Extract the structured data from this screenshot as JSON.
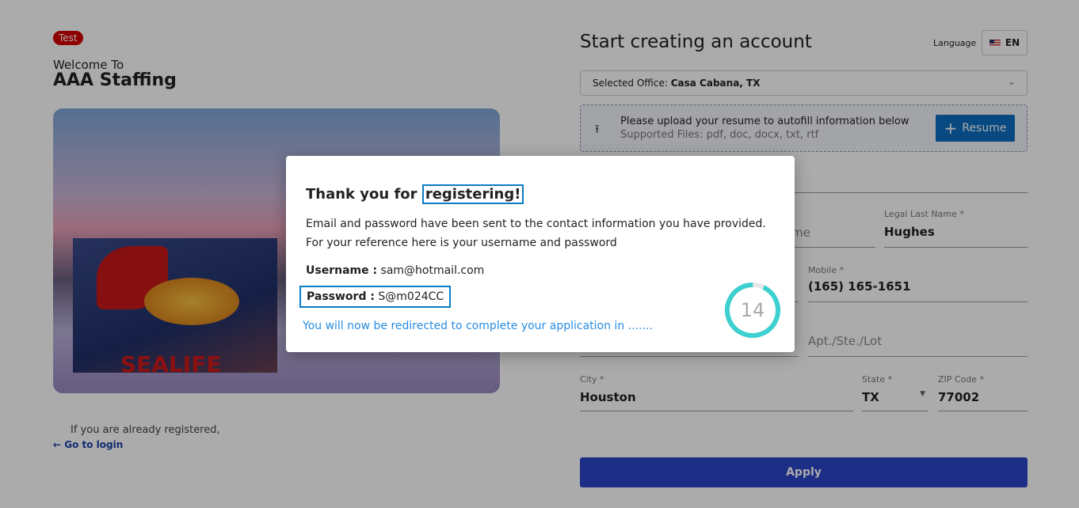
{
  "left": {
    "badge": "Test",
    "welcome": "Welcome To",
    "brand": "AAA Staffing",
    "already": "If you are already registered,",
    "login": "Go to login"
  },
  "header": {
    "title": "Start creating an account",
    "language_label": "Language",
    "language": "EN"
  },
  "office": {
    "label": "Selected Office:",
    "value": "Casa Cabana, TX"
  },
  "upload": {
    "line1": "Please upload your resume to autofill information below",
    "line2": "Supported Files: pdf, doc, docx, txt, rtf",
    "button": "Resume"
  },
  "form": {
    "first_partial": "me",
    "last_label": "Legal Last Name *",
    "last_value": "Hughes",
    "mobile_label": "Mobile *",
    "mobile_value": "(165) 165-1651",
    "apt_placeholder": "Apt./Ste./Lot",
    "city_label": "City *",
    "city_value": "Houston",
    "state_label": "State *",
    "state_value": "TX",
    "zip_label": "ZIP Code *",
    "zip_value": "77002",
    "apply": "Apply"
  },
  "modal": {
    "title_prefix": "Thank you for ",
    "title_highlight": "registering!",
    "line1": "Email and password have been sent to the contact information you have provided.",
    "line2": "For your reference here is your username and password",
    "username_label": "Username :",
    "username": "sam@hotmail.com",
    "password_label": "Password :",
    "password": "S@m024CC",
    "redirect": "You will now be redirected to complete your application in .......",
    "countdown": "14",
    "countdown_progress": 0.93,
    "ring_color": "#3ecfd0"
  }
}
